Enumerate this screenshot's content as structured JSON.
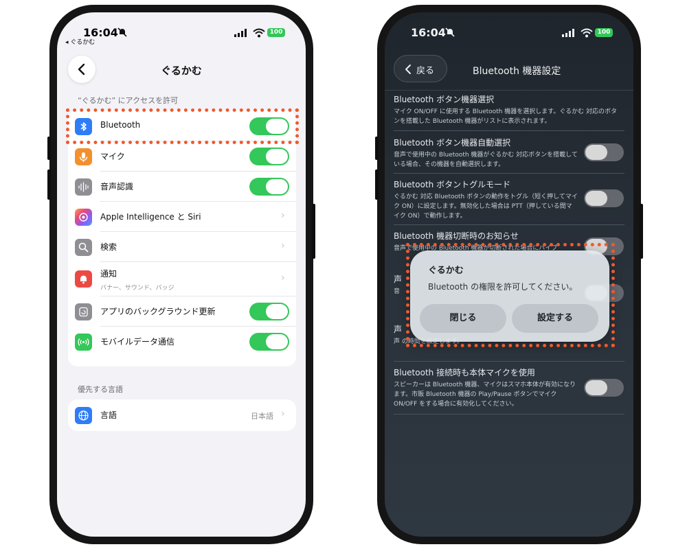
{
  "left": {
    "status": {
      "time": "16:04",
      "back_app": "◂ ぐるかむ",
      "battery": "100"
    },
    "nav_title": "ぐるかむ",
    "section_access": "“ぐるかむ” にアクセスを許可",
    "rows": [
      {
        "label": "Bluetooth",
        "icon": "bluetooth-icon",
        "control": "toggle",
        "on": true
      },
      {
        "label": "マイク",
        "icon": "microphone-icon",
        "control": "toggle",
        "on": true
      },
      {
        "label": "音声認識",
        "icon": "waveform-icon",
        "control": "toggle",
        "on": true
      },
      {
        "label": "Apple Intelligence と Siri",
        "icon": "siri-icon",
        "control": "chevron"
      },
      {
        "label": "検索",
        "icon": "search-icon",
        "control": "chevron"
      },
      {
        "label": "通知",
        "sub": "バナー、サウンド、バッジ",
        "icon": "notification-icon",
        "control": "chevron"
      },
      {
        "label": "アプリのバックグラウンド更新",
        "icon": "background-refresh-icon",
        "control": "toggle",
        "on": true
      },
      {
        "label": "モバイルデータ通信",
        "icon": "cellular-icon",
        "control": "toggle",
        "on": true
      }
    ],
    "section_language": "優先する言語",
    "language_row": {
      "label": "言語",
      "value": "日本語",
      "icon": "globe-icon"
    }
  },
  "right": {
    "status": {
      "time": "16:04",
      "battery": "100"
    },
    "back_label": "戻る",
    "title": "Bluetooth 機器設定",
    "settings": [
      {
        "title": "Bluetooth ボタン機器選択",
        "desc": "マイク ON/OFF に使用する Bluetooth 機器を選択します。ぐるかむ 対応のボタンを搭載した Bluetooth 機器がリストに表示されます。"
      },
      {
        "title": "Bluetooth ボタン機器自動選択",
        "desc": "音声で使用中の Bluetooth 機器がぐるかむ 対応ボタンを搭載している場合、その機器を自動選択します。",
        "on": false
      },
      {
        "title": "Bluetooth ボタントグルモード",
        "desc": "ぐるかむ 対応 Bluetooth ボタンの動作をトグル（短く押してマイク ON）に設定します。無効化した場合は PTT（押している間マイク ON）で動作します。",
        "on": false
      },
      {
        "title": "Bluetooth 機器切断時のお知らせ",
        "desc": "音声で使用中の Bluetooth 機器が切断された場合にバイブ",
        "on": false
      },
      {
        "title": "声",
        "desc": "音",
        "on": false
      },
      {
        "title": "声",
        "desc": "声 の時間を設定します。"
      },
      {
        "title": "Bluetooth 接続時も本体マイクを使用",
        "desc": "スピーカーは Bluetooth 機器、マイクはスマホ本体が有効になります。市販 Bluetooth 機器の Play/Pause ボタンでマイク ON/OFF をする場合に有効化してください。",
        "on": false
      }
    ],
    "dialog": {
      "title": "ぐるかむ",
      "message": "Bluetooth の権限を許可してください。",
      "close_label": "閉じる",
      "settings_label": "設定する"
    }
  },
  "colors": {
    "highlight": "#ef5a2e",
    "toggle_on": "#34c759"
  }
}
